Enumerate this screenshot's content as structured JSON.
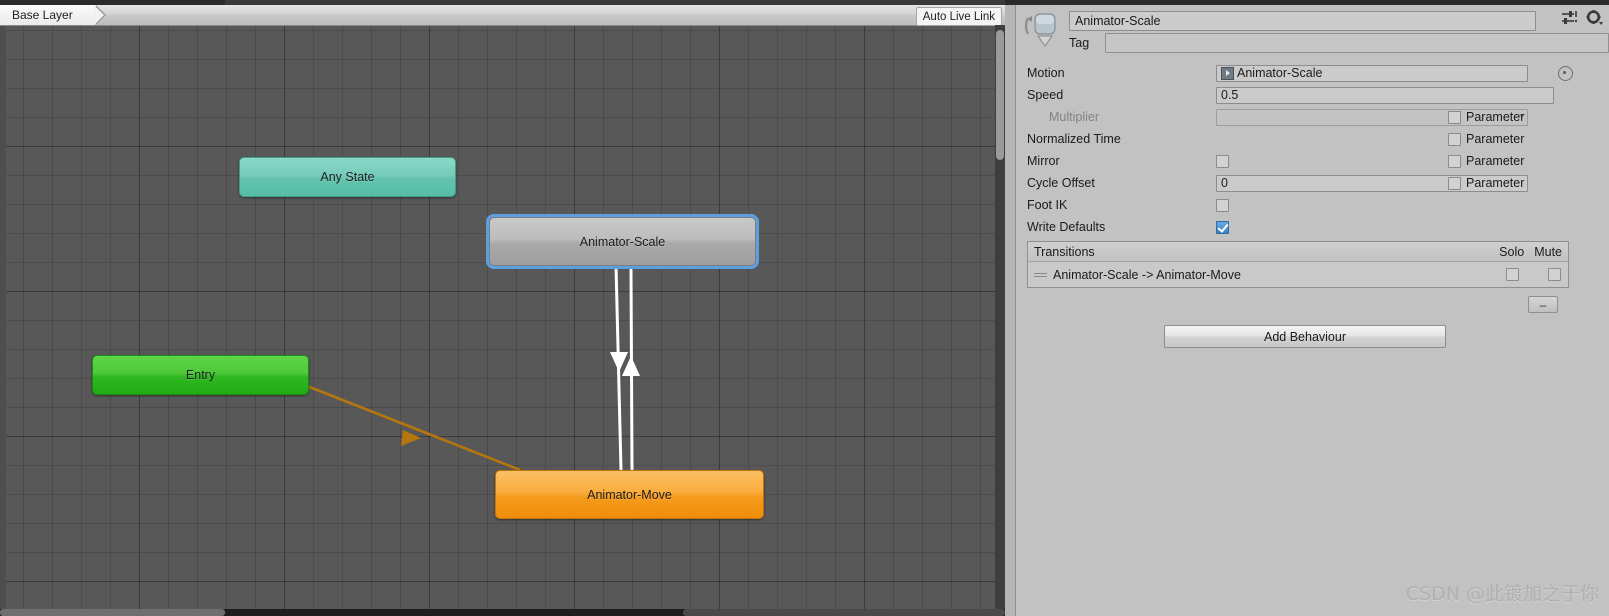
{
  "graph": {
    "breadcrumb": "Base Layer",
    "live_link_label": "Auto Live Link",
    "nodes": [
      {
        "id": "any-state",
        "label": "Any State",
        "color": "#63c3ae",
        "selected": false
      },
      {
        "id": "entry",
        "label": "Entry",
        "color": "#2fb821",
        "selected": false
      },
      {
        "id": "animator-scale",
        "label": "Animator-Scale",
        "color": "#a9a9a9",
        "selected": true
      },
      {
        "id": "animator-move",
        "label": "Animator-Move",
        "color": "#f59b1d",
        "selected": false
      }
    ],
    "transitions": [
      {
        "from": "entry",
        "to": "animator-move",
        "color": "#b5770d",
        "style": "single"
      },
      {
        "from": "animator-scale",
        "to": "animator-move",
        "color": "#ffffff",
        "style": "double-down"
      },
      {
        "from": "animator-move",
        "to": "animator-scale",
        "color": "#ffffff",
        "style": "double-up"
      }
    ]
  },
  "inspector": {
    "state_name": "Animator-Scale",
    "tag_label": "Tag",
    "tag_value": "",
    "header_icons": [
      "preset-sliders-icon",
      "gear-icon"
    ],
    "properties": [
      {
        "label": "Motion",
        "value": "Animator-Scale",
        "field": "object",
        "param": false,
        "param_label": ""
      },
      {
        "label": "Speed",
        "value": "0.5",
        "field": "text",
        "param": false,
        "param_label": ""
      },
      {
        "label": "Multiplier",
        "value": "",
        "field": "dropdown",
        "param": true,
        "param_label": "Parameter",
        "sub": true,
        "disabled": true
      },
      {
        "label": "Normalized Time",
        "value": "",
        "field": "none",
        "param": true,
        "param_label": "Parameter"
      },
      {
        "label": "Mirror",
        "value": false,
        "field": "checkbox",
        "param": true,
        "param_label": "Parameter"
      },
      {
        "label": "Cycle Offset",
        "value": "0",
        "field": "text",
        "param": true,
        "param_label": "Parameter"
      },
      {
        "label": "Foot IK",
        "value": false,
        "field": "checkbox",
        "param": false,
        "param_label": ""
      },
      {
        "label": "Write Defaults",
        "value": true,
        "field": "checkbox",
        "param": false,
        "param_label": ""
      }
    ],
    "transitions_panel": {
      "title": "Transitions",
      "col_solo": "Solo",
      "col_mute": "Mute",
      "rows": [
        {
          "label": "Animator-Scale -> Animator-Move",
          "solo": false,
          "mute": false
        }
      ],
      "remove_label": "–"
    },
    "add_behaviour_label": "Add Behaviour"
  },
  "watermark": "CSDN @此镀加之于你"
}
